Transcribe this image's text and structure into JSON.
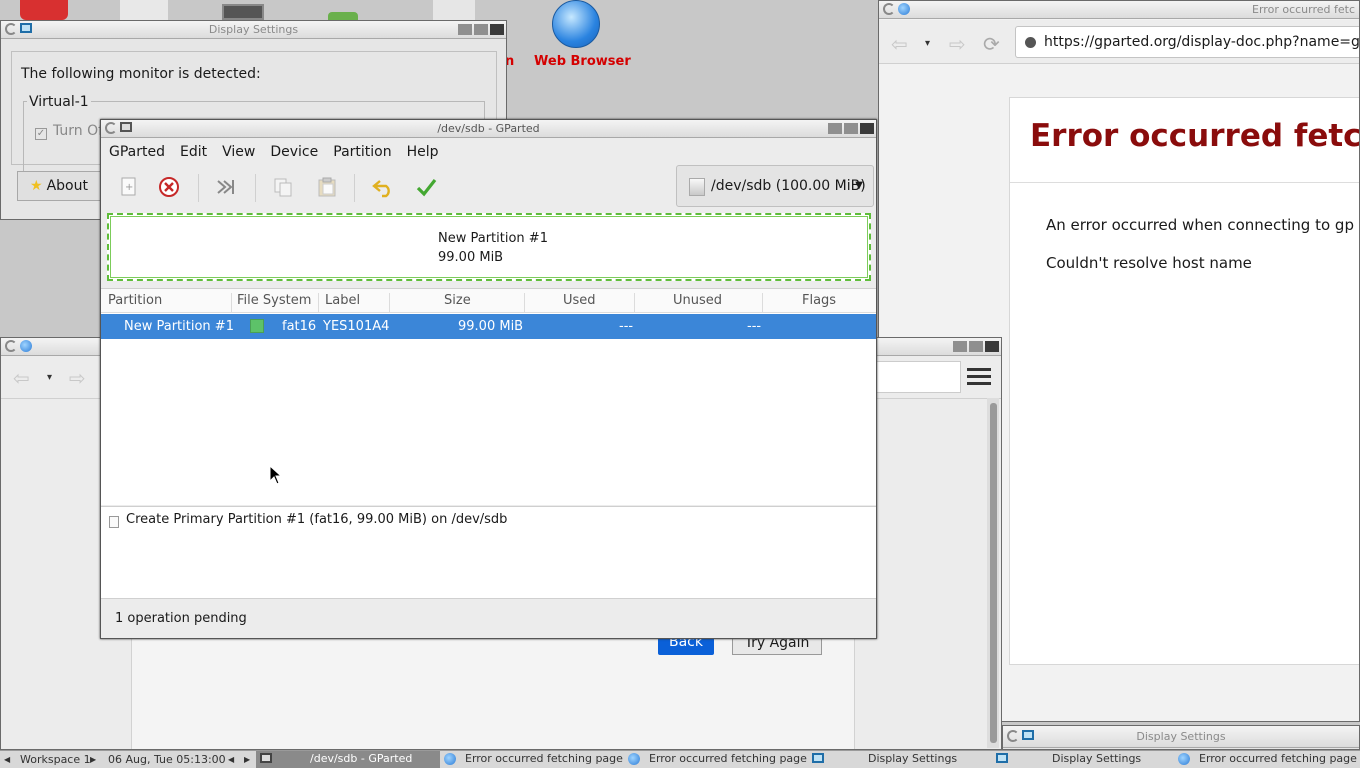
{
  "desktop": {
    "web_browser_label": "Web Browser",
    "partial_label": "n"
  },
  "browser_right": {
    "title": "Error occurred fetc",
    "url": "https://gparted.org/display-doc.php?name=gparted",
    "error_title": "Error occurred fetching",
    "error_line1": "An error occurred when connecting to gp",
    "error_line2": "Couldn't resolve host name"
  },
  "browser_left": {
    "back_button": "Back",
    "try_again_button": "Try Again"
  },
  "display_settings_top": {
    "title": "Display Settings",
    "detected_text": "The following monitor is detected:",
    "monitor_name": "Virtual-1",
    "turn_off_label": "Turn Of",
    "about_button": "About"
  },
  "display_settings_br": {
    "title": "Display Settings"
  },
  "gparted": {
    "title": "/dev/sdb - GParted",
    "menu": [
      "GParted",
      "Edit",
      "View",
      "Device",
      "Partition",
      "Help"
    ],
    "device_selector": "/dev/sdb (100.00 MiB)",
    "map_partition_name": "New Partition #1",
    "map_partition_size": "99.00 MiB",
    "columns": [
      "Partition",
      "File System",
      "Label",
      "Size",
      "Used",
      "Unused",
      "Flags"
    ],
    "rows": [
      {
        "partition": "New Partition #1",
        "file_system": "fat16",
        "label": "YES101A4",
        "size": "99.00 MiB",
        "used": "---",
        "unused": "---",
        "flags": ""
      }
    ],
    "operation": "Create Primary Partition #1 (fat16, 99.00 MiB) on /dev/sdb",
    "status": "1 operation pending",
    "colors": {
      "selection": "#3b86d8",
      "fat16": "#5dc269",
      "map_border": "#5fbd3a"
    }
  },
  "taskbar": {
    "workspace": "Workspace 1",
    "clock": "06 Aug, Tue 05:13:00",
    "items": [
      {
        "label": "/dev/sdb - GParted",
        "icon": "gparted-icon",
        "active": true
      },
      {
        "label": "Error occurred fetching page -",
        "icon": "globe-icon",
        "active": false
      },
      {
        "label": "Error occurred fetching page -",
        "icon": "globe-icon",
        "active": false
      },
      {
        "label": "Display Settings",
        "icon": "monitor-icon",
        "active": false
      },
      {
        "label": "Display Settings",
        "icon": "monitor-icon",
        "active": false
      },
      {
        "label": "Error occurred fetching page -",
        "icon": "globe-icon",
        "active": false
      }
    ]
  }
}
